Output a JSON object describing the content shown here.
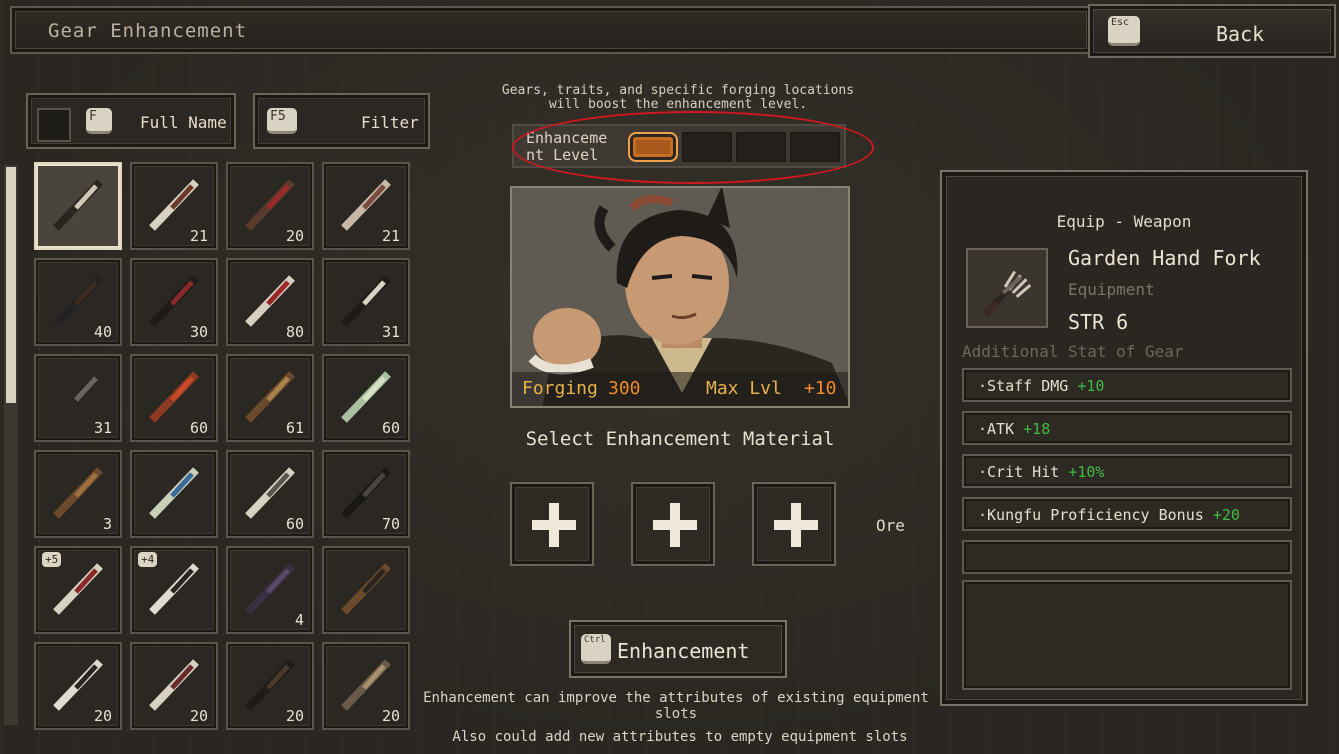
{
  "header": {
    "title": "Gear Enhancement",
    "back_key": "Esc",
    "back_label": "Back"
  },
  "toolbar": {
    "full_name_key": "F",
    "full_name_label": "Full Name",
    "filter_key": "F5",
    "filter_label": "Filter"
  },
  "inventory": [
    {
      "icon": "hand-fork-icon",
      "count": "",
      "badge": "",
      "selected": true
    },
    {
      "icon": "cleaver-icon",
      "count": "21",
      "badge": ""
    },
    {
      "icon": "spear-icon",
      "count": "20",
      "badge": ""
    },
    {
      "icon": "dagger-icon",
      "count": "21",
      "badge": ""
    },
    {
      "icon": "shovel-icon",
      "count": "40",
      "badge": ""
    },
    {
      "icon": "staff-icon",
      "count": "30",
      "badge": ""
    },
    {
      "icon": "gauntlet-icon",
      "count": "80",
      "badge": ""
    },
    {
      "icon": "armor-icon",
      "count": "31",
      "badge": ""
    },
    {
      "icon": "robe-icon",
      "count": "31",
      "badge": ""
    },
    {
      "icon": "pouch-icon",
      "count": "60",
      "badge": ""
    },
    {
      "icon": "hat-icon",
      "count": "61",
      "badge": ""
    },
    {
      "icon": "jade-pendant-icon",
      "count": "60",
      "badge": ""
    },
    {
      "icon": "sandal-icon",
      "count": "3",
      "badge": ""
    },
    {
      "icon": "jade-ring-icon",
      "count": "",
      "badge": ""
    },
    {
      "icon": "fan-icon",
      "count": "60",
      "badge": ""
    },
    {
      "icon": "book-icon",
      "count": "70",
      "badge": ""
    },
    {
      "icon": "broadsword-icon",
      "count": "",
      "badge": "+5"
    },
    {
      "icon": "sabre-icon",
      "count": "",
      "badge": "+4"
    },
    {
      "icon": "dark-robe-icon",
      "count": "4",
      "badge": ""
    },
    {
      "icon": "straw-sandal-icon",
      "count": "",
      "badge": ""
    },
    {
      "icon": "needle-spear-icon",
      "count": "20",
      "badge": ""
    },
    {
      "icon": "butcher-knife-icon",
      "count": "20",
      "badge": ""
    },
    {
      "icon": "rod-icon",
      "count": "20",
      "badge": ""
    },
    {
      "icon": "bracer-icon",
      "count": "20",
      "badge": ""
    }
  ],
  "enhance": {
    "hint_line1": "Gears, traits, and specific forging locations",
    "hint_line2": "will boost the enhancement level.",
    "level_label_line1": "Enhanceme",
    "level_label_line2": "nt Level",
    "level_filled": 1,
    "level_total": 4,
    "forging_label": "Forging",
    "forging_value": "300",
    "max_lvl_label": "Max Lvl",
    "max_lvl_value": "+10",
    "select_title": "Select Enhancement Material",
    "ore_label": "Ore",
    "button_key": "Ctrl",
    "button_label": "Enhancement",
    "footer_line1": "Enhancement can improve the attributes of existing equipment slots",
    "footer_line2": "Also could add new attributes to empty equipment slots"
  },
  "details": {
    "equip_type": "Equip - Weapon",
    "item_name": "Garden Hand Fork",
    "item_category": "Equipment",
    "requirement": "STR 6",
    "additional_title": "Additional Stat of Gear",
    "stats": [
      {
        "name": "·Staff DMG",
        "value": "+10"
      },
      {
        "name": "·ATK",
        "value": "+18"
      },
      {
        "name": "·Crit Hit",
        "value": "+10%"
      },
      {
        "name": "·Kungfu Proficiency Bonus",
        "value": "+20"
      }
    ]
  },
  "colors": {
    "accent_orange": "#ef8a2a",
    "forging_gold": "#e8b24a",
    "stat_green": "#3fbb3f",
    "highlight_red": "#d0181e"
  }
}
